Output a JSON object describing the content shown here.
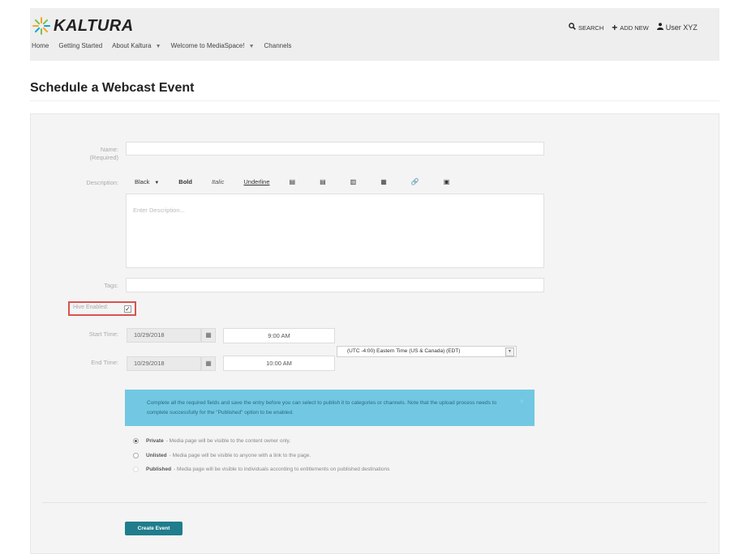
{
  "brand": {
    "name": "KALTURA"
  },
  "nav": [
    {
      "label": "Home"
    },
    {
      "label": "Getting Started"
    },
    {
      "label": "About Kaltura",
      "has_caret": true
    },
    {
      "label": "Welcome to MediaSpace!",
      "has_caret": true
    },
    {
      "label": "Channels"
    }
  ],
  "top_actions": {
    "search": "SEARCH",
    "add_new": "ADD NEW",
    "user": "User XYZ"
  },
  "page": {
    "title": "Schedule a Webcast Event"
  },
  "form": {
    "name_label": "Name:",
    "name_required": "(Required)",
    "description_label": "Description:",
    "toolbar": {
      "color": "Black",
      "bold": "Bold",
      "italic": "Italic",
      "underline": "Underline"
    },
    "description_placeholder": "Enter Description...",
    "tags_label": "Tags:",
    "hive_label": "Hive Enabled:",
    "hive_checked": true,
    "start_label": "Start Time:",
    "start_date": "10/29/2018",
    "start_time": "9:00 AM",
    "end_label": "End Time:",
    "end_date": "10/29/2018",
    "end_time": "10:00 AM",
    "timezone": "(UTC -4:00) Eastern Time (US & Canada) (EDT)"
  },
  "alert": {
    "text": "Complete all the required fields and save the entry before you can select to publish it to categories or channels. Note that the upload process needs to complete successfully for the \"Published\" option to be enabled.",
    "close": "×"
  },
  "publish_options": [
    {
      "title": "Private",
      "desc": "- Media page will be visible to the content owner only.",
      "selected": true
    },
    {
      "title": "Unlisted",
      "desc": "- Media page will be visible to anyone with a link to the page.",
      "selected": false
    },
    {
      "title": "Published",
      "desc": "- Media page will be visible to individuals according to entitlements on published destinations",
      "selected": false
    }
  ],
  "actions": {
    "create": "Create Event"
  },
  "colors": {
    "accent": "#1f7d8c",
    "alert_bg": "#5bc0de",
    "highlight": "#d9534f"
  }
}
